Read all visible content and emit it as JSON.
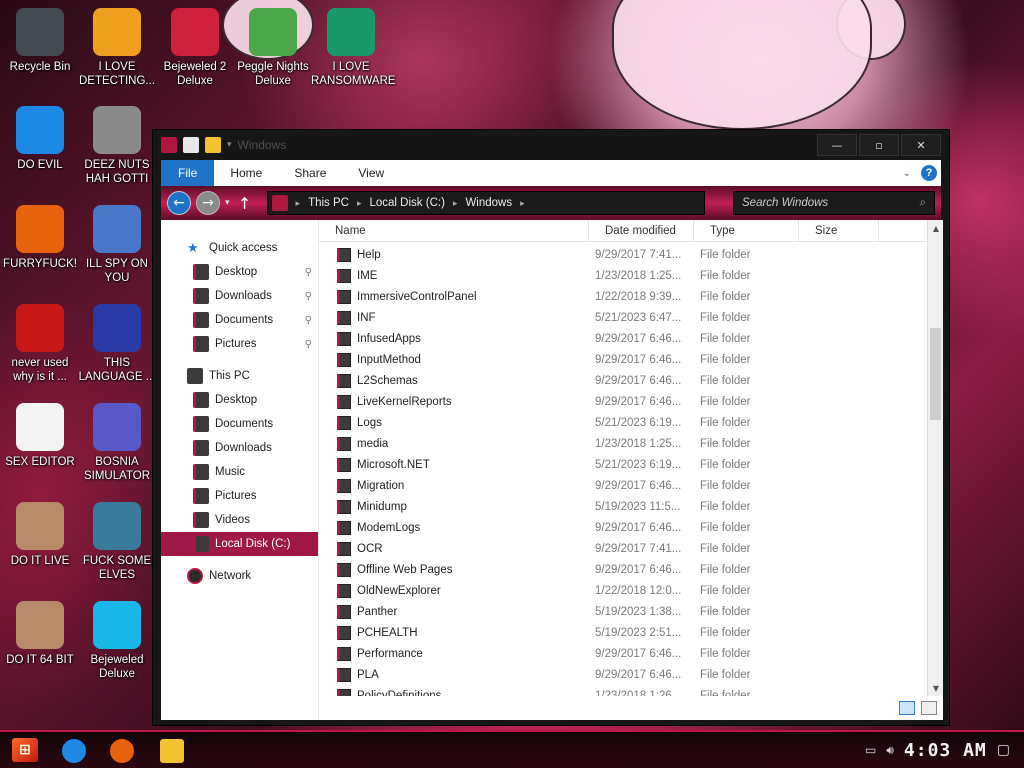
{
  "desktop_icons": [
    {
      "label": "Recycle Bin",
      "icon": "recycle-bin-icon",
      "color": "#444a52"
    },
    {
      "label": "I LOVE DETECTING...",
      "icon": "die-icon",
      "color": "#f0a020"
    },
    {
      "label": "Bejeweled 2 Deluxe",
      "icon": "bejeweled-2-icon",
      "color": "#d02040"
    },
    {
      "label": "Peggle Nights Deluxe",
      "icon": "peggle-icon",
      "color": "#4aa84a"
    },
    {
      "label": "I LOVE RANSOMWARE",
      "icon": "project-icon",
      "color": "#1a9a6a"
    },
    {
      "label": "DO EVIL",
      "icon": "chrome-icon",
      "color": "#1e88e5"
    },
    {
      "label": "DEEZ NUTS HAH GOTTI",
      "icon": "windows-stack-icon",
      "color": "#8a8a8a"
    },
    {
      "label": "FURRYFUCK!",
      "icon": "firefox-icon",
      "color": "#e8610c"
    },
    {
      "label": "ILL SPY ON YOU",
      "icon": "network-spy-icon",
      "color": "#4a78c8"
    },
    {
      "label": "never used why is it ...",
      "icon": "dev-cpp-icon",
      "color": "#c81818"
    },
    {
      "label": "THIS LANGUAGE ...",
      "icon": "goland-icon",
      "color": "#2a3aa8"
    },
    {
      "label": "SEX EDITOR",
      "icon": "hxd-icon",
      "color": "#f4f4f4"
    },
    {
      "label": "BOSNIA SIMULATOR",
      "icon": "spiked-ball-icon",
      "color": "#5a58c8"
    },
    {
      "label": "DO IT LIVE",
      "icon": "portrait-icon",
      "color": "#b88a68"
    },
    {
      "label": "FUCK SOME ELVES",
      "icon": "elf-icon",
      "color": "#3a7a9a"
    },
    {
      "label": "DO IT 64 BIT",
      "icon": "portrait-64-icon",
      "color": "#b88a68"
    },
    {
      "label": "Bejeweled Deluxe",
      "icon": "diamond-icon",
      "color": "#18b8e8"
    }
  ],
  "window": {
    "title": "Windows",
    "buttons": [
      "—",
      "▫",
      "✕"
    ],
    "ribbon_tabs": [
      "File",
      "Home",
      "Share",
      "View"
    ],
    "breadcrumb": [
      "This PC",
      "Local Disk (C:)",
      "Windows"
    ],
    "search_placeholder": "Search Windows"
  },
  "navpane": {
    "quick_access": "Quick access",
    "quick_items": [
      "Desktop",
      "Downloads",
      "Documents",
      "Pictures"
    ],
    "this_pc": "This PC",
    "pc_items": [
      "Desktop",
      "Documents",
      "Downloads",
      "Music",
      "Pictures",
      "Videos",
      "Local Disk (C:)"
    ],
    "network": "Network"
  },
  "columns": {
    "name": "Name",
    "date": "Date modified",
    "type": "Type",
    "size": "Size"
  },
  "files": [
    {
      "name": "Help",
      "date": "9/29/2017 7:41...",
      "type": "File folder"
    },
    {
      "name": "IME",
      "date": "1/23/2018 1:25...",
      "type": "File folder"
    },
    {
      "name": "ImmersiveControlPanel",
      "date": "1/22/2018 9:39...",
      "type": "File folder"
    },
    {
      "name": "INF",
      "date": "5/21/2023 6:47...",
      "type": "File folder"
    },
    {
      "name": "InfusedApps",
      "date": "9/29/2017 6:46...",
      "type": "File folder"
    },
    {
      "name": "InputMethod",
      "date": "9/29/2017 6:46...",
      "type": "File folder"
    },
    {
      "name": "L2Schemas",
      "date": "9/29/2017 6:46...",
      "type": "File folder"
    },
    {
      "name": "LiveKernelReports",
      "date": "9/29/2017 6:46...",
      "type": "File folder"
    },
    {
      "name": "Logs",
      "date": "5/21/2023 6:19...",
      "type": "File folder"
    },
    {
      "name": "media",
      "date": "1/23/2018 1:25...",
      "type": "File folder"
    },
    {
      "name": "Microsoft.NET",
      "date": "5/21/2023 6:19...",
      "type": "File folder"
    },
    {
      "name": "Migration",
      "date": "9/29/2017 6:46...",
      "type": "File folder"
    },
    {
      "name": "Minidump",
      "date": "5/19/2023 11:5...",
      "type": "File folder"
    },
    {
      "name": "ModemLogs",
      "date": "9/29/2017 6:46...",
      "type": "File folder"
    },
    {
      "name": "OCR",
      "date": "9/29/2017 7:41...",
      "type": "File folder"
    },
    {
      "name": "Offline Web Pages",
      "date": "9/29/2017 6:46...",
      "type": "File folder"
    },
    {
      "name": "OldNewExplorer",
      "date": "1/22/2018 12:0...",
      "type": "File folder"
    },
    {
      "name": "Panther",
      "date": "5/19/2023 1:38...",
      "type": "File folder"
    },
    {
      "name": "PCHEALTH",
      "date": "5/19/2023 2:51...",
      "type": "File folder"
    },
    {
      "name": "Performance",
      "date": "9/29/2017 6:46...",
      "type": "File folder"
    },
    {
      "name": "PLA",
      "date": "9/29/2017 6:46...",
      "type": "File folder"
    },
    {
      "name": "PolicyDefinitions",
      "date": "1/23/2018 1:26...",
      "type": "File folder"
    }
  ],
  "taskbar": {
    "clock": "4:03 AM",
    "pinned": [
      {
        "icon": "chrome-icon",
        "color": "#1e88e5"
      },
      {
        "icon": "firefox-icon",
        "color": "#e8610c"
      },
      {
        "icon": "file-explorer-icon",
        "color": "#f2c230"
      }
    ]
  },
  "colors": {
    "accent": "#c0174a",
    "selected": "#a01848",
    "file_tab": "#1e73c8"
  }
}
